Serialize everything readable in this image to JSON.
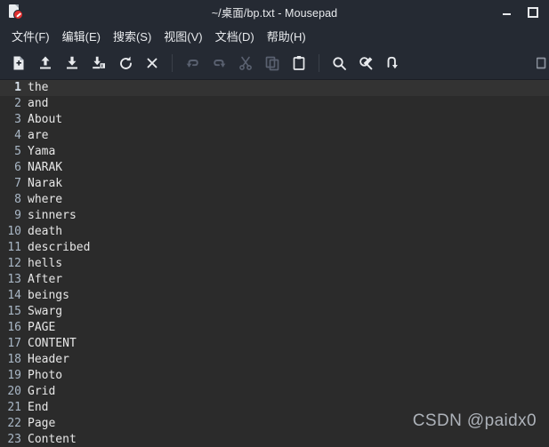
{
  "window": {
    "title": "~/桌面/bp.txt - Mousepad",
    "app_icon": "document-edit-icon",
    "controls": {
      "minimize": "minimize-icon",
      "maximize": "maximize-icon"
    }
  },
  "menubar": {
    "items": [
      {
        "label": "文件(F)",
        "name": "menu-file"
      },
      {
        "label": "编辑(E)",
        "name": "menu-edit"
      },
      {
        "label": "搜索(S)",
        "name": "menu-search"
      },
      {
        "label": "视图(V)",
        "name": "menu-view"
      },
      {
        "label": "文档(D)",
        "name": "menu-document"
      },
      {
        "label": "帮助(H)",
        "name": "menu-help"
      }
    ]
  },
  "toolbar": {
    "buttons": [
      {
        "name": "new-document-button",
        "icon": "new-document-icon",
        "enabled": true
      },
      {
        "name": "open-file-button",
        "icon": "open-file-icon",
        "enabled": true
      },
      {
        "name": "save-button",
        "icon": "save-icon",
        "enabled": true
      },
      {
        "name": "save-as-button",
        "icon": "save-as-icon",
        "enabled": true
      },
      {
        "name": "reload-button",
        "icon": "reload-icon",
        "enabled": true
      },
      {
        "name": "close-tab-button",
        "icon": "close-icon",
        "enabled": true
      },
      {
        "name": "undo-button",
        "icon": "undo-icon",
        "enabled": false
      },
      {
        "name": "redo-button",
        "icon": "redo-icon",
        "enabled": false
      },
      {
        "name": "cut-button",
        "icon": "scissors-icon",
        "enabled": false
      },
      {
        "name": "copy-button",
        "icon": "copy-icon",
        "enabled": false
      },
      {
        "name": "paste-button",
        "icon": "clipboard-icon",
        "enabled": true
      },
      {
        "name": "find-button",
        "icon": "search-icon",
        "enabled": true
      },
      {
        "name": "find-replace-button",
        "icon": "find-replace-icon",
        "enabled": true
      },
      {
        "name": "go-to-line-button",
        "icon": "go-to-line-icon",
        "enabled": true
      }
    ]
  },
  "editor": {
    "active_line": 1,
    "lines": [
      {
        "no": "1",
        "text": "the"
      },
      {
        "no": "2",
        "text": "and"
      },
      {
        "no": "3",
        "text": "About"
      },
      {
        "no": "4",
        "text": "are"
      },
      {
        "no": "5",
        "text": "Yama"
      },
      {
        "no": "6",
        "text": "NARAK"
      },
      {
        "no": "7",
        "text": "Narak"
      },
      {
        "no": "8",
        "text": "where"
      },
      {
        "no": "9",
        "text": "sinners"
      },
      {
        "no": "10",
        "text": "death"
      },
      {
        "no": "11",
        "text": "described"
      },
      {
        "no": "12",
        "text": "hells"
      },
      {
        "no": "13",
        "text": "After"
      },
      {
        "no": "14",
        "text": "beings"
      },
      {
        "no": "15",
        "text": "Swarg"
      },
      {
        "no": "16",
        "text": "PAGE"
      },
      {
        "no": "17",
        "text": "CONTENT"
      },
      {
        "no": "18",
        "text": "Header"
      },
      {
        "no": "19",
        "text": "Photo"
      },
      {
        "no": "20",
        "text": "Grid"
      },
      {
        "no": "21",
        "text": "End"
      },
      {
        "no": "22",
        "text": "Page"
      },
      {
        "no": "23",
        "text": "Content"
      }
    ]
  },
  "watermark": {
    "text": "CSDN @paidx0"
  },
  "colors": {
    "chrome_bg": "#252a33",
    "editor_bg": "#2b2b2b",
    "active_line_bg": "#333333",
    "text": "#e6e6e6",
    "line_number": "#a9b7c6",
    "icon_enabled": "#e8eaed",
    "icon_disabled": "#5a6170",
    "badge_red": "#e03131"
  }
}
